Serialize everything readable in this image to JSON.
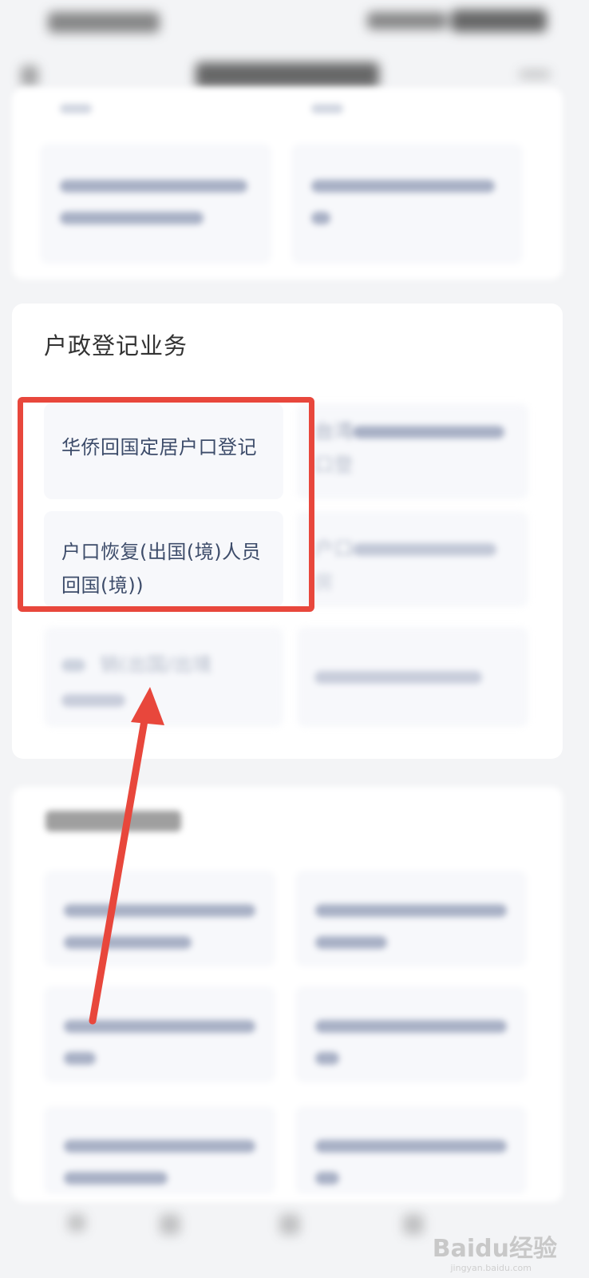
{
  "section": {
    "title": "户政登记业务"
  },
  "highlighted_items": [
    {
      "label_line1": "华侨回国定居户口登记",
      "label_line2": ""
    },
    {
      "label_line1": "户口恢复(出国(境)人员",
      "label_line2": "回国(境))"
    }
  ],
  "partial_items": [
    {
      "fragment_1": "台湾",
      "fragment_2": "口登"
    },
    {
      "fragment_1": "户口",
      "fragment_2": "房"
    },
    {
      "fragment_1": "销(出国/出境"
    }
  ],
  "watermark": {
    "brand": "Baidu经验",
    "site": "jingyan.baidu.com"
  },
  "colors": {
    "highlight": "#e8473c",
    "arrow": "#e8473c",
    "tile_bg": "#f7f8fb",
    "text": "#3d4c6a"
  },
  "icons": [
    "back-arrow-icon",
    "more-icon",
    "annotation-arrow-icon",
    "baidu-paw-icon"
  ]
}
